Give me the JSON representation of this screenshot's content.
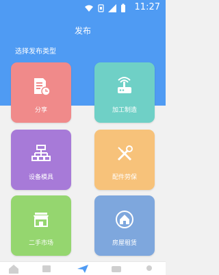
{
  "status_bar": {
    "time": "11:27",
    "icons": [
      "wifi-icon",
      "sim-icon",
      "signal-icon",
      "battery-icon"
    ]
  },
  "header": {
    "title": "发布",
    "subtitle": "选择发布类型"
  },
  "tiles": [
    {
      "label": "分享",
      "icon": "document-clock-icon",
      "color": "#f08a8a"
    },
    {
      "label": "加工制造",
      "icon": "router-icon",
      "color": "#6fd0c6"
    },
    {
      "label": "设备模具",
      "icon": "hierarchy-icon",
      "color": "#a77ad8"
    },
    {
      "label": "配件劳保",
      "icon": "tools-icon",
      "color": "#f7c27a"
    },
    {
      "label": "二手市场",
      "icon": "storefront-icon",
      "color": "#95d66f"
    },
    {
      "label": "房屋租赁",
      "icon": "house-icon",
      "color": "#7ea7dd"
    }
  ],
  "bottom_nav": {
    "icons": [
      "home-icon",
      "list-icon",
      "send-icon",
      "chat-icon",
      "profile-icon"
    ],
    "active_color": "#4f9bf3"
  }
}
